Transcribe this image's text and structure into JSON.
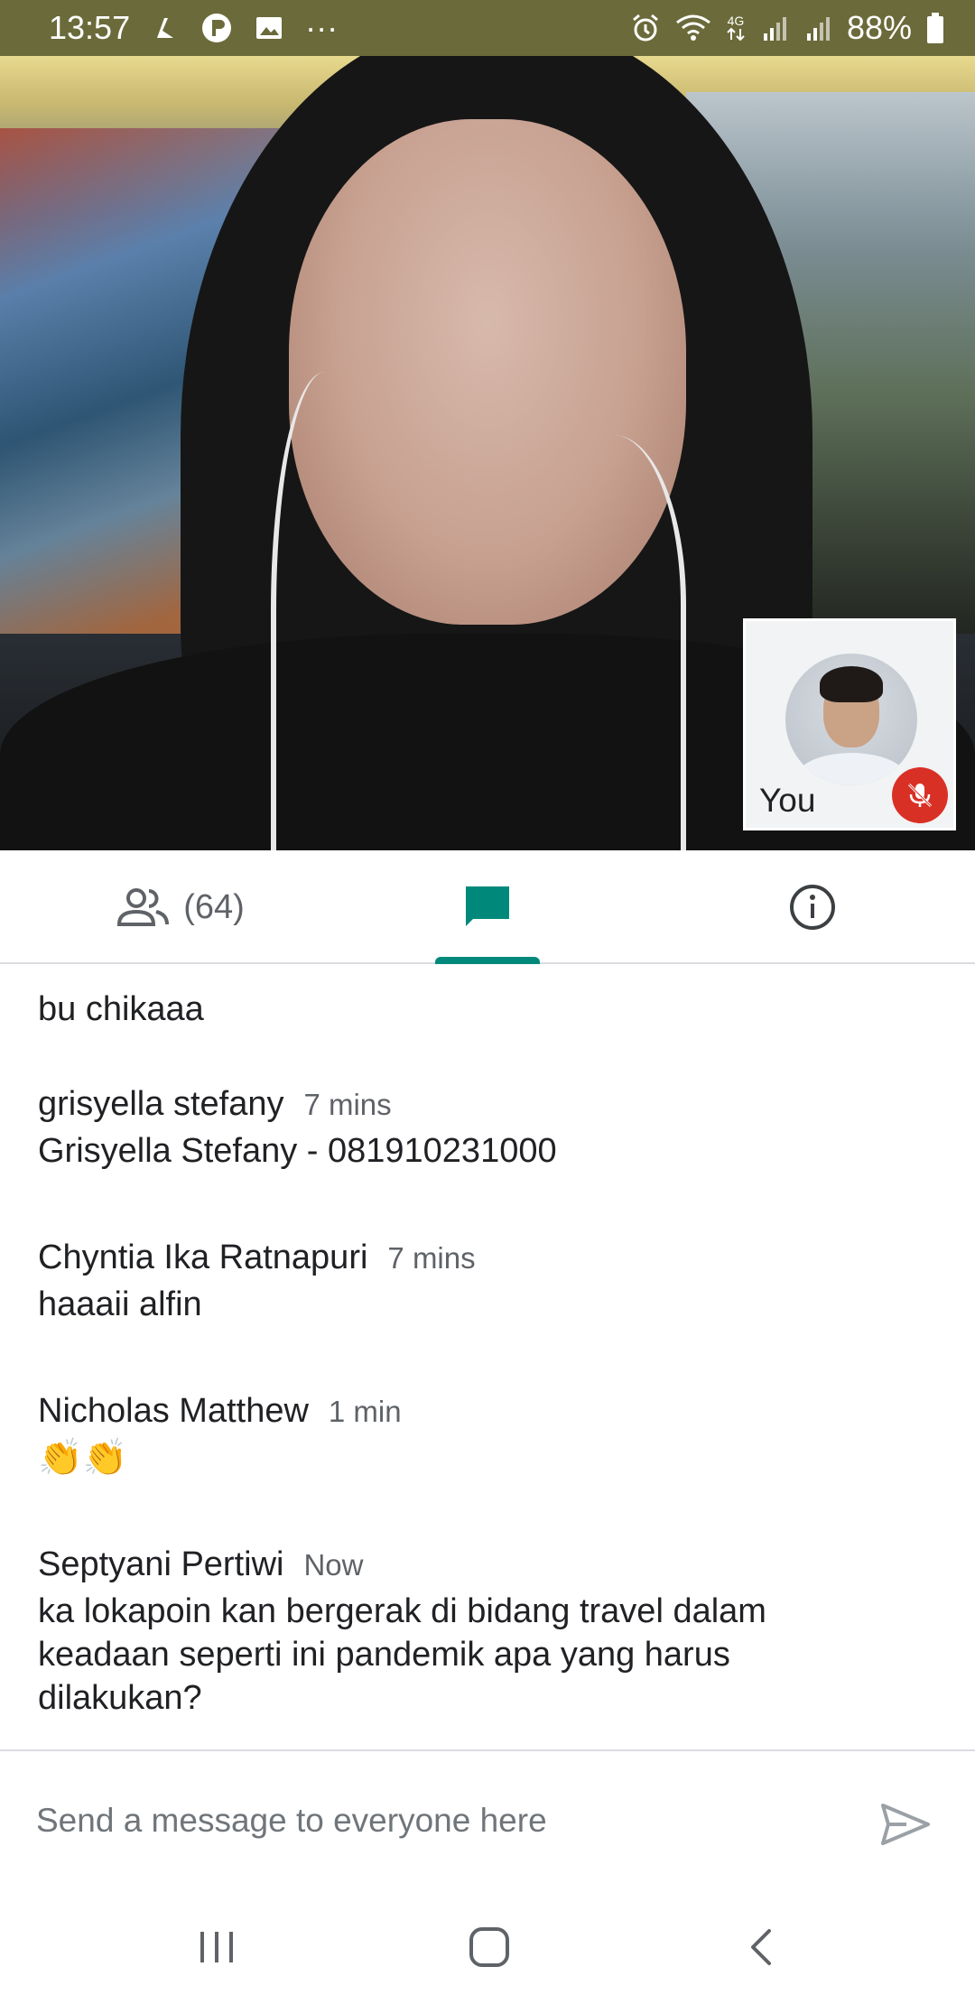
{
  "status_bar": {
    "time": "13:57",
    "network": "4G",
    "battery": "88%",
    "more": "···",
    "icons_left": [
      "app-notification-icon",
      "p-notification-icon",
      "gallery-icon"
    ],
    "icons_right": [
      "alarm-icon",
      "wifi-icon",
      "network-icon",
      "signal-icon",
      "signal-icon-2",
      "battery-icon"
    ]
  },
  "self_view": {
    "label": "You",
    "mic_icon": "mic-off-icon"
  },
  "tabs": {
    "people_count": "(64)",
    "people_icon": "people-icon",
    "chat_icon": "chat-icon",
    "info_icon": "info-icon",
    "active": "chat",
    "accent_color": "#00897b"
  },
  "chat": {
    "partial_message": "bu chikaaa",
    "messages": [
      {
        "sender": "grisyella stefany",
        "time": "7 mins",
        "text": "Grisyella Stefany - 081910231000"
      },
      {
        "sender": "Chyntia Ika Ratnapuri",
        "time": "7 mins",
        "text": "haaaii alfin"
      },
      {
        "sender": "Nicholas Matthew",
        "time": "1 min",
        "text": "👏👏"
      },
      {
        "sender": "Septyani Pertiwi",
        "time": "Now",
        "text": "ka lokapoin kan bergerak di bidang travel dalam keadaan seperti ini pandemik apa yang harus dilakukan?"
      }
    ]
  },
  "composer": {
    "placeholder": "Send a message to everyone here",
    "value": "",
    "send_icon": "send-icon"
  },
  "navbar": {
    "icons": [
      "recent-apps-icon",
      "home-icon",
      "back-icon"
    ]
  }
}
